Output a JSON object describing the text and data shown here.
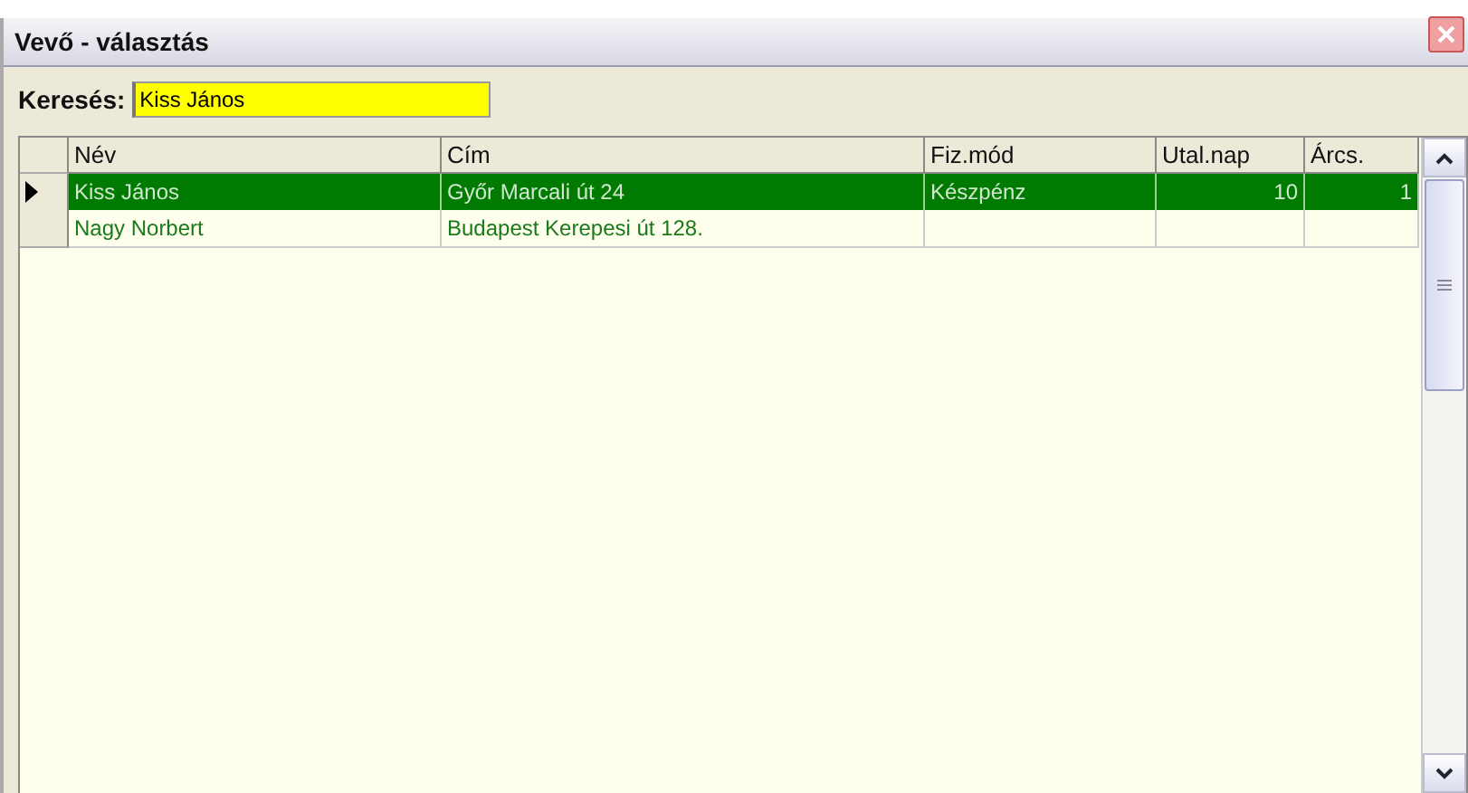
{
  "window": {
    "title": "Vevő - választás"
  },
  "search": {
    "label": "Keresés:",
    "value": "Kiss János"
  },
  "table": {
    "columns": [
      {
        "label": "Név",
        "kind": "text"
      },
      {
        "label": "Cím",
        "kind": "text"
      },
      {
        "label": "Fiz.mód",
        "kind": "text"
      },
      {
        "label": "Utal.nap",
        "kind": "number"
      },
      {
        "label": "Árcs.",
        "kind": "number"
      }
    ],
    "rows": [
      {
        "selected": true,
        "cells": [
          "Kiss János",
          "Győr Marcali út 24",
          "Készpénz",
          "10",
          "1"
        ]
      },
      {
        "selected": false,
        "cells": [
          "Nagy Norbert",
          "Budapest Kerepesi út 128.",
          "",
          "",
          ""
        ]
      }
    ]
  }
}
